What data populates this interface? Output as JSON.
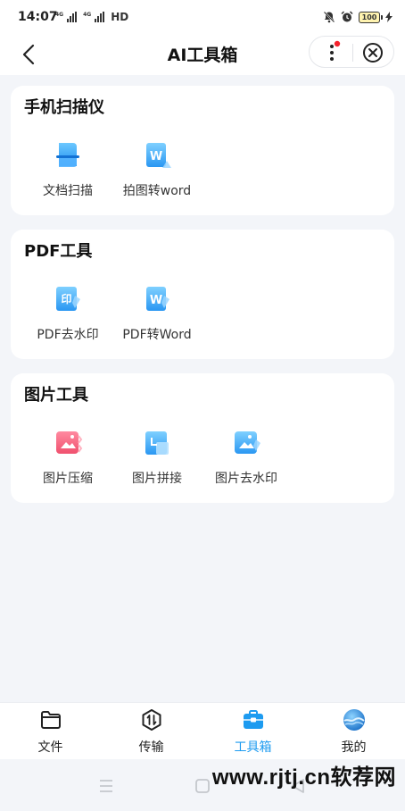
{
  "status_bar": {
    "time": "14:07",
    "network_tag_1": "4G",
    "network_tag_2": "4G",
    "network_type": "HD",
    "battery": "100"
  },
  "nav": {
    "title": "AI工具箱",
    "has_notification_dot": true
  },
  "sections": [
    {
      "title": "手机扫描仪",
      "tools": [
        {
          "label": "文档扫描",
          "icon": "document-scan-icon"
        },
        {
          "label": "拍图转word",
          "icon": "photo-to-word-icon"
        }
      ]
    },
    {
      "title": "PDF工具",
      "tools": [
        {
          "label": "PDF去水印",
          "icon": "pdf-watermark-remove-icon"
        },
        {
          "label": "PDF转Word",
          "icon": "pdf-to-word-icon"
        }
      ]
    },
    {
      "title": "图片工具",
      "tools": [
        {
          "label": "图片压缩",
          "icon": "image-compress-icon"
        },
        {
          "label": "图片拼接",
          "icon": "image-stitch-icon"
        },
        {
          "label": "图片去水印",
          "icon": "image-watermark-remove-icon"
        }
      ]
    }
  ],
  "tabbar": {
    "tabs": [
      {
        "label": "文件",
        "icon": "folder-icon",
        "active": false
      },
      {
        "label": "传输",
        "icon": "transfer-icon",
        "active": false
      },
      {
        "label": "工具箱",
        "icon": "toolbox-icon",
        "active": true
      },
      {
        "label": "我的",
        "icon": "profile-avatar-icon",
        "active": false
      }
    ]
  },
  "watermark": "www.rjtj.cn软荐网",
  "colors": {
    "accent": "#1d9bf0",
    "background": "#f3f5f9",
    "card": "#ffffff",
    "notification_dot": "#f5222d",
    "image_compress": "#f0506e"
  }
}
